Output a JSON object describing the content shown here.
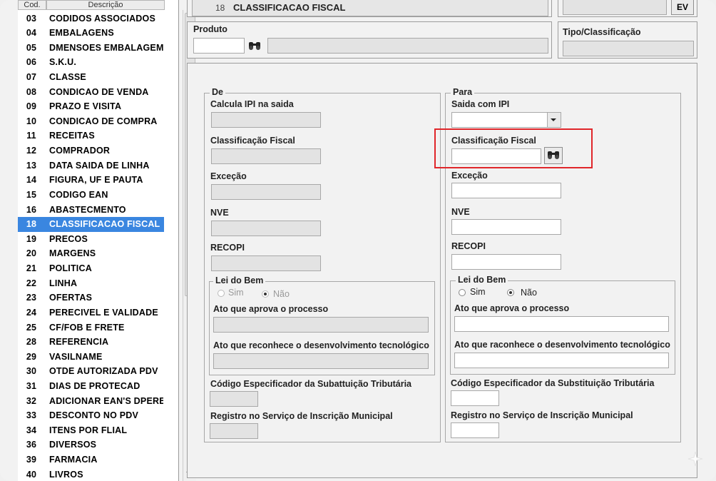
{
  "list": {
    "col_code": "Cod.",
    "col_desc": "Descrição",
    "items": [
      {
        "code": "03",
        "desc": "CODIDOS ASSOCIADOS"
      },
      {
        "code": "04",
        "desc": "EMBALAGENS"
      },
      {
        "code": "05",
        "desc": "DMENSOES EMBALAGEM"
      },
      {
        "code": "06",
        "desc": "S.K.U."
      },
      {
        "code": "07",
        "desc": "CLASSE"
      },
      {
        "code": "08",
        "desc": "CONDICAO DE VENDA"
      },
      {
        "code": "09",
        "desc": "PRAZO E VISITA"
      },
      {
        "code": "10",
        "desc": "CONDICAO DE COMPRA"
      },
      {
        "code": "11",
        "desc": "RECEITAS"
      },
      {
        "code": "12",
        "desc": "COMPRADOR"
      },
      {
        "code": "13",
        "desc": "DATA SAIDA DE LINHA"
      },
      {
        "code": "14",
        "desc": "FIGURA, UF E PAUTA"
      },
      {
        "code": "15",
        "desc": "CODIGO EAN"
      },
      {
        "code": "16",
        "desc": "ABASTECMENTO"
      },
      {
        "code": "18",
        "desc": "CLASSIFICACAO FISCAL"
      },
      {
        "code": "19",
        "desc": "PRECOS"
      },
      {
        "code": "20",
        "desc": "MARGENS"
      },
      {
        "code": "21",
        "desc": "POLITICA"
      },
      {
        "code": "22",
        "desc": "LINHA"
      },
      {
        "code": "23",
        "desc": "OFERTAS"
      },
      {
        "code": "24",
        "desc": "PERECIVEL E VALIDADE"
      },
      {
        "code": "25",
        "desc": "CF/FOB E FRETE"
      },
      {
        "code": "28",
        "desc": "REFERENCIA"
      },
      {
        "code": "29",
        "desc": "VASILNAME"
      },
      {
        "code": "30",
        "desc": "OTDE AUTORIZADA PDV"
      },
      {
        "code": "31",
        "desc": "DIAS DE PROTECAD"
      },
      {
        "code": "32",
        "desc": "ADICIONAR EAN'S DPERE!"
      },
      {
        "code": "33",
        "desc": "DESCONTO NO PDV"
      },
      {
        "code": "34",
        "desc": "ITENS POR FLIAL"
      },
      {
        "code": "36",
        "desc": "DIVERSOS"
      },
      {
        "code": "39",
        "desc": "FARMACIA"
      },
      {
        "code": "40",
        "desc": "LIVROS"
      }
    ],
    "selected_code": "18"
  },
  "header": {
    "number": "18",
    "title": "CLASSIFICACAO FISCAL",
    "ev_button": "EV",
    "produto_label": "Produto",
    "tipo_label": "Tipo/Classificação"
  },
  "de": {
    "legend": "De",
    "calcula_ipi": "Calcula IPI na saida",
    "classificacao": "Classificação Fiscal",
    "excecao": "Exceção",
    "nve": "NVE",
    "recopi": "RECOPI",
    "lei_legend": "Lei do Bem",
    "sim": "Sim",
    "nao": "Não",
    "ato_aprova": "Ato que aprova o processo",
    "ato_reconhece": "Ato que reconhece o desenvolvimento tecnológico",
    "codigo_especificador": "Código Especificador da Subattuição Tributária",
    "registro_servico": "Registro no Serviço de Inscrição Municipal"
  },
  "para": {
    "legend": "Para",
    "saida_ipi": "Saida com IPI",
    "classificacao": "Classificação Fiscal",
    "excecao": "Exceção",
    "nve": "NVE",
    "recopi": "RECOPI",
    "lei_legend": "Lei do Bem",
    "sim": "Sim",
    "nao": "Não",
    "ato_aprova": "Ato que aprova o processo",
    "ato_reconhece": "Ato que raconhece o desenvolvimento tecnológico",
    "codigo_especificador": "Código Especificador da Substituição Tributária",
    "registro_servico": "Registro no Serviço de Inscrição Municipal"
  },
  "colors": {
    "selection": "#3a86e0",
    "highlight": "#e0262a"
  }
}
